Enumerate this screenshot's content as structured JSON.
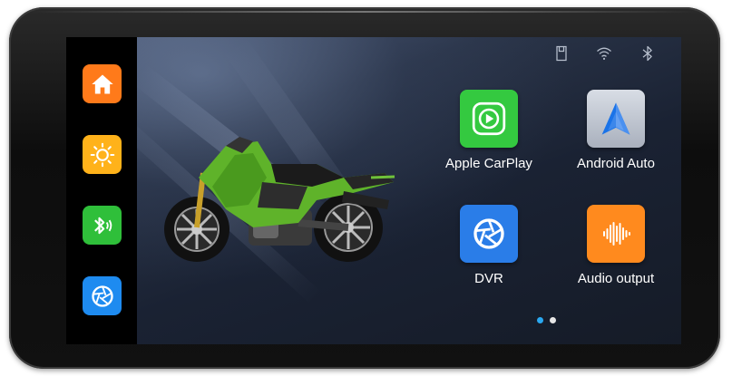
{
  "sidebar": {
    "items": [
      {
        "name": "home",
        "color": "#ff7a1a",
        "icon": "home-icon"
      },
      {
        "name": "brightness",
        "color": "#ffb21a",
        "icon": "sun-icon"
      },
      {
        "name": "bluetooth",
        "color": "#2fbf3a",
        "icon": "bluetooth-audio-icon"
      },
      {
        "name": "dvr",
        "color": "#1e8bf0",
        "icon": "camera-aperture-icon"
      }
    ]
  },
  "status_bar": {
    "icons": [
      "sd-card-icon",
      "wifi-icon",
      "bluetooth-icon"
    ]
  },
  "apps": [
    {
      "label": "Apple CarPlay",
      "color": "#34c940",
      "icon": "carplay-play-icon"
    },
    {
      "label": "Android Auto",
      "color": "#c8cdd6",
      "icon": "android-auto-icon"
    },
    {
      "label": "DVR",
      "color": "#2a7de8",
      "icon": "camera-aperture-icon"
    },
    {
      "label": "Audio output",
      "color": "#ff8a1e",
      "icon": "sound-wave-icon"
    }
  ],
  "pagination": {
    "pages": 2,
    "active": 1,
    "active_color": "#2aa8f0",
    "inactive_color": "#e6e6e6"
  }
}
